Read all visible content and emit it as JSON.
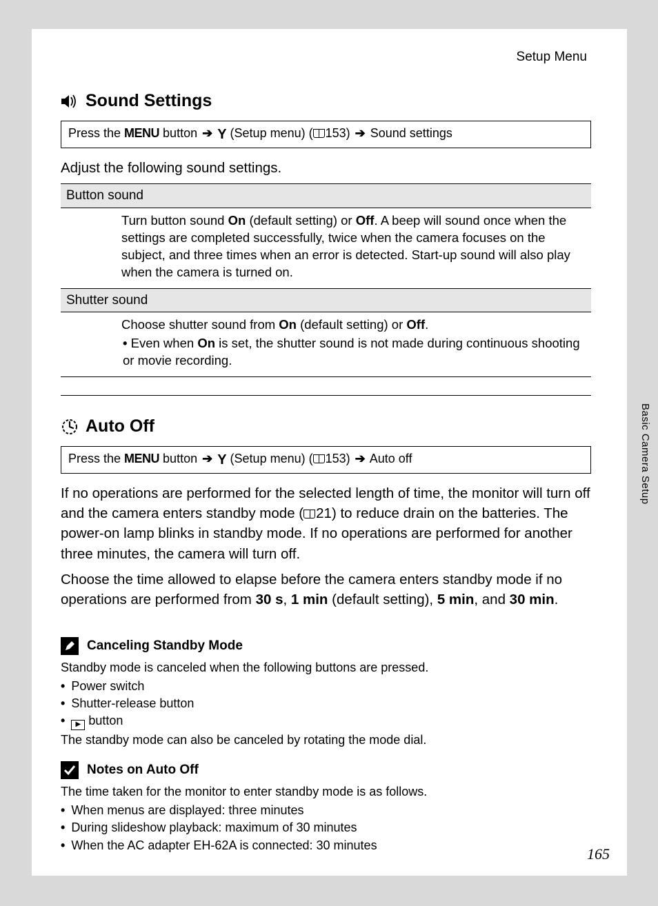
{
  "header": {
    "breadcrumb": "Setup Menu"
  },
  "section1": {
    "title": "Sound Settings",
    "nav": {
      "prefix": "Press the ",
      "menu": "MENU",
      "mid1": " button ",
      "setup": " (Setup menu) (",
      "ref": "153",
      "mid2": ") ",
      "dest": " Sound settings"
    },
    "intro": "Adjust the following sound settings.",
    "row1": {
      "head": "Button sound",
      "body_a": "Turn button sound ",
      "on": "On",
      "body_b": " (default setting) or ",
      "off": "Off",
      "body_c": ". A beep will sound once when the settings are completed successfully, twice when the camera focuses on the subject, and three times when an error is detected. Start-up sound will also play when the camera is turned on."
    },
    "row2": {
      "head": "Shutter sound",
      "body_a": "Choose shutter sound from ",
      "on": "On",
      "body_b": " (default setting) or ",
      "off": "Off",
      "body_c": ".",
      "bullet_a": "Even when ",
      "bullet_on": "On",
      "bullet_b": " is set, the shutter sound is not made during continuous shooting or movie recording."
    }
  },
  "section2": {
    "title": "Auto Off",
    "nav": {
      "prefix": "Press the ",
      "menu": "MENU",
      "mid1": " button ",
      "setup": " (Setup menu) (",
      "ref": "153",
      "mid2": ") ",
      "dest": " Auto off"
    },
    "para_a": "If no operations are performed for the selected length of time, the monitor will turn off and the camera enters standby mode (",
    "para_ref": "21",
    "para_b": ") to reduce drain on the batteries. The power-on lamp blinks in standby mode. If no operations are performed for another three minutes, the camera will turn off.",
    "para2_a": "Choose the time allowed to elapse before the camera enters standby mode if no operations are performed from ",
    "opt1": "30 s",
    "sep1": ", ",
    "opt2": "1 min",
    "opt2_suffix": " (default setting), ",
    "opt3": "5 min",
    "sep2": ", and ",
    "opt4": "30 min",
    "end": "."
  },
  "note1": {
    "title": "Canceling Standby Mode",
    "intro": "Standby mode is canceled when the following buttons are pressed.",
    "b1": "Power switch",
    "b2": "Shutter-release button",
    "b3": " button",
    "outro": "The standby mode can also be canceled by rotating the mode dial."
  },
  "note2": {
    "title": "Notes on Auto Off",
    "intro": "The time taken for the monitor to enter standby mode is as follows.",
    "b1": "When menus are displayed: three minutes",
    "b2": "During slideshow playback: maximum of 30 minutes",
    "b3": "When the AC adapter EH-62A is connected: 30 minutes"
  },
  "side": {
    "label": "Basic Camera Setup"
  },
  "pagenum": "165"
}
